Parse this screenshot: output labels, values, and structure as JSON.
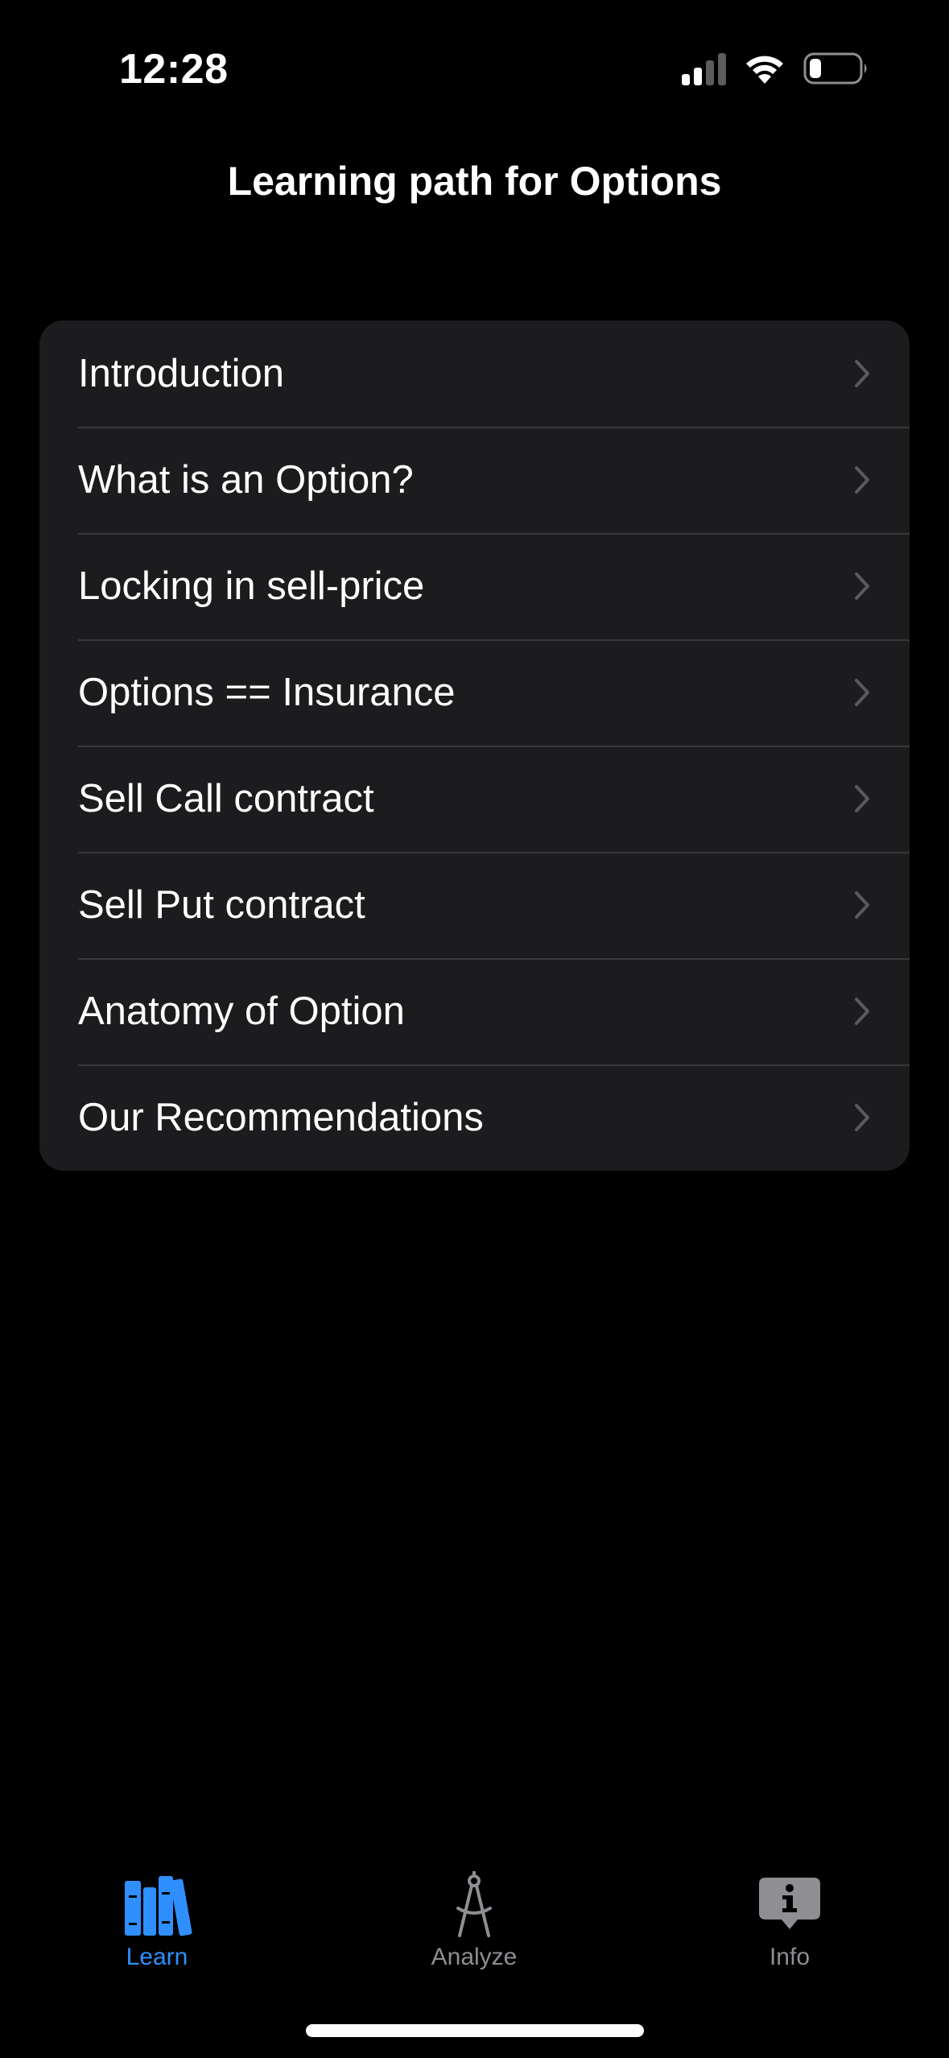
{
  "status_bar": {
    "time": "12:28"
  },
  "nav": {
    "title": "Learning path for Options"
  },
  "lessons": [
    {
      "label": "Introduction"
    },
    {
      "label": "What is an Option?"
    },
    {
      "label": "Locking in sell-price"
    },
    {
      "label": "Options == Insurance"
    },
    {
      "label": "Sell Call contract"
    },
    {
      "label": "Sell Put contract"
    },
    {
      "label": "Anatomy of Option"
    },
    {
      "label": "Our Recommendations"
    }
  ],
  "tabs": [
    {
      "label": "Learn",
      "icon": "books-icon",
      "selected": true
    },
    {
      "label": "Analyze",
      "icon": "compass-icon",
      "selected": false
    },
    {
      "label": "Info",
      "icon": "info-bubble-icon",
      "selected": false
    }
  ],
  "colors": {
    "accent": "#2f8fff",
    "background": "#000000",
    "card": "#1c1c1e",
    "separator": "#38383a",
    "inactive_tab": "#8e8e93",
    "chevron": "#5a5a5e"
  }
}
